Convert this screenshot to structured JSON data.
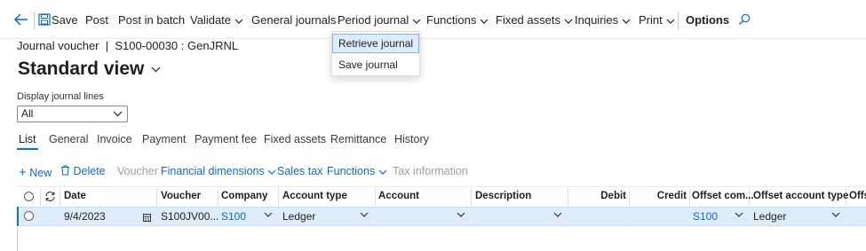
{
  "toolbar": {
    "save": "Save",
    "post": "Post",
    "post_in_batch": "Post in batch",
    "validate": "Validate",
    "general_journals": "General journals",
    "period_journal": "Period journal",
    "functions": "Functions",
    "fixed_assets": "Fixed assets",
    "inquiries": "Inquiries",
    "print": "Print",
    "options": "Options"
  },
  "period_journal_menu": [
    "Retrieve journal",
    "Save journal"
  ],
  "breadcrumb": "Journal voucher  |  S100-00030 : GenJRNL",
  "view_title": "Standard view",
  "display_lines": {
    "label": "Display journal lines",
    "value": "All"
  },
  "tabs": [
    "List",
    "General",
    "Invoice",
    "Payment",
    "Payment fee",
    "Fixed assets",
    "Remittance",
    "History"
  ],
  "action_bar": {
    "new": "New",
    "delete": "Delete",
    "voucher": "Voucher",
    "financial_dimensions": "Financial dimensions",
    "sales_tax": "Sales tax",
    "functions": "Functions",
    "tax_information": "Tax information"
  },
  "grid": {
    "columns": [
      "Date",
      "Voucher",
      "Company",
      "Account type",
      "Account",
      "Description",
      "Debit",
      "Credit",
      "Offset com...",
      "Offset account type",
      "Offs"
    ],
    "row": {
      "date": "9/4/2023",
      "voucher": "S100JV00...",
      "company": "S100",
      "account_type": "Ledger",
      "account": "",
      "description": "",
      "debit": "",
      "credit": "",
      "offset_company": "S100",
      "offset_account_type": "Ledger"
    }
  },
  "colors": {
    "accent": "#0078d4",
    "link": "#0f6cbd",
    "selected_row": "#deecf9"
  }
}
